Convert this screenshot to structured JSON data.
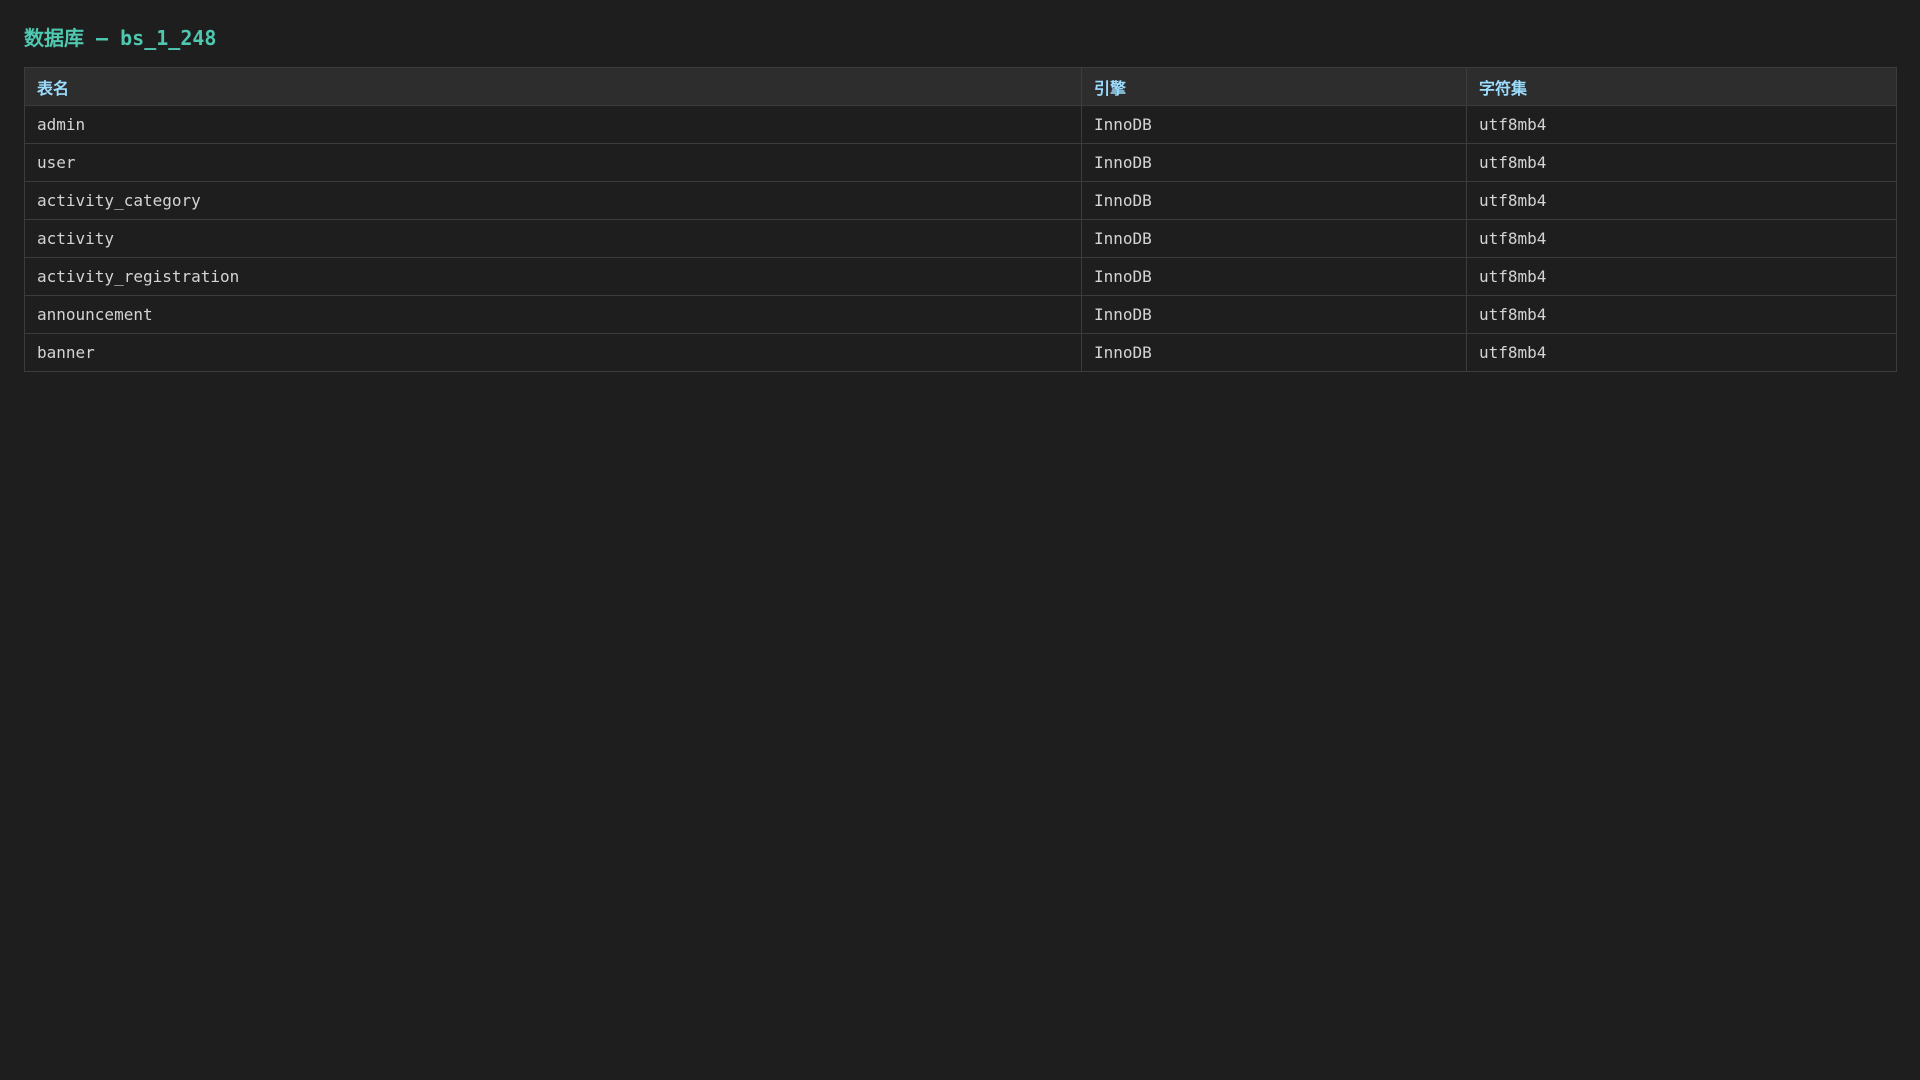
{
  "title": {
    "prefix": "数据库 — ",
    "database": "bs_1_248"
  },
  "table": {
    "columns": [
      "表名",
      "引擎",
      "字符集"
    ],
    "rows": [
      {
        "name": "admin",
        "engine": "InnoDB",
        "charset": "utf8mb4"
      },
      {
        "name": "user",
        "engine": "InnoDB",
        "charset": "utf8mb4"
      },
      {
        "name": "activity_category",
        "engine": "InnoDB",
        "charset": "utf8mb4"
      },
      {
        "name": "activity",
        "engine": "InnoDB",
        "charset": "utf8mb4"
      },
      {
        "name": "activity_registration",
        "engine": "InnoDB",
        "charset": "utf8mb4"
      },
      {
        "name": "announcement",
        "engine": "InnoDB",
        "charset": "utf8mb4"
      },
      {
        "name": "banner",
        "engine": "InnoDB",
        "charset": "utf8mb4"
      }
    ]
  },
  "colors": {
    "background": "#1e1e1e",
    "title": "#4ec9b0",
    "header_text": "#9cdcfe",
    "header_background": "#2d2d2d",
    "cell_text": "#d4d4d4",
    "border": "#3c3c3c"
  }
}
